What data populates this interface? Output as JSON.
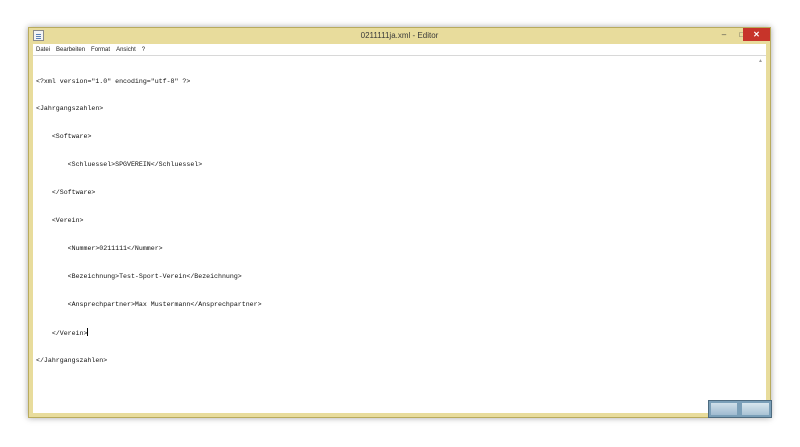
{
  "window": {
    "title": "0211111ja.xml - Editor",
    "min_glyph": "–",
    "max_glyph": "□",
    "close_glyph": "✕"
  },
  "menu": {
    "items": [
      {
        "label": "Datei"
      },
      {
        "label": "Bearbeiten"
      },
      {
        "label": "Format"
      },
      {
        "label": "Ansicht"
      },
      {
        "label": "?"
      }
    ]
  },
  "editor": {
    "lines": [
      "<?xml version=\"1.0\" encoding=\"utf-8\" ?>",
      "<Jahrgangszahlen>",
      "    <Software>",
      "        <Schluessel>SPGVEREIN</Schluessel>",
      "    </Software>",
      "    <Verein>",
      "        <Nummer>0211111</Nummer>",
      "        <Bezeichnung>Test-Sport-Verein</Bezeichnung>",
      "        <Ansprechpartner>Max Mustermann</Ansprechpartner>",
      "    </Verein>",
      "</Jahrgangszahlen>"
    ],
    "caret_line": 9
  },
  "colors": {
    "frame": "#e8dc9c",
    "close": "#c7342a"
  },
  "icons": {
    "app": "notepad-icon",
    "scroll_up": "chevron-up-icon"
  }
}
